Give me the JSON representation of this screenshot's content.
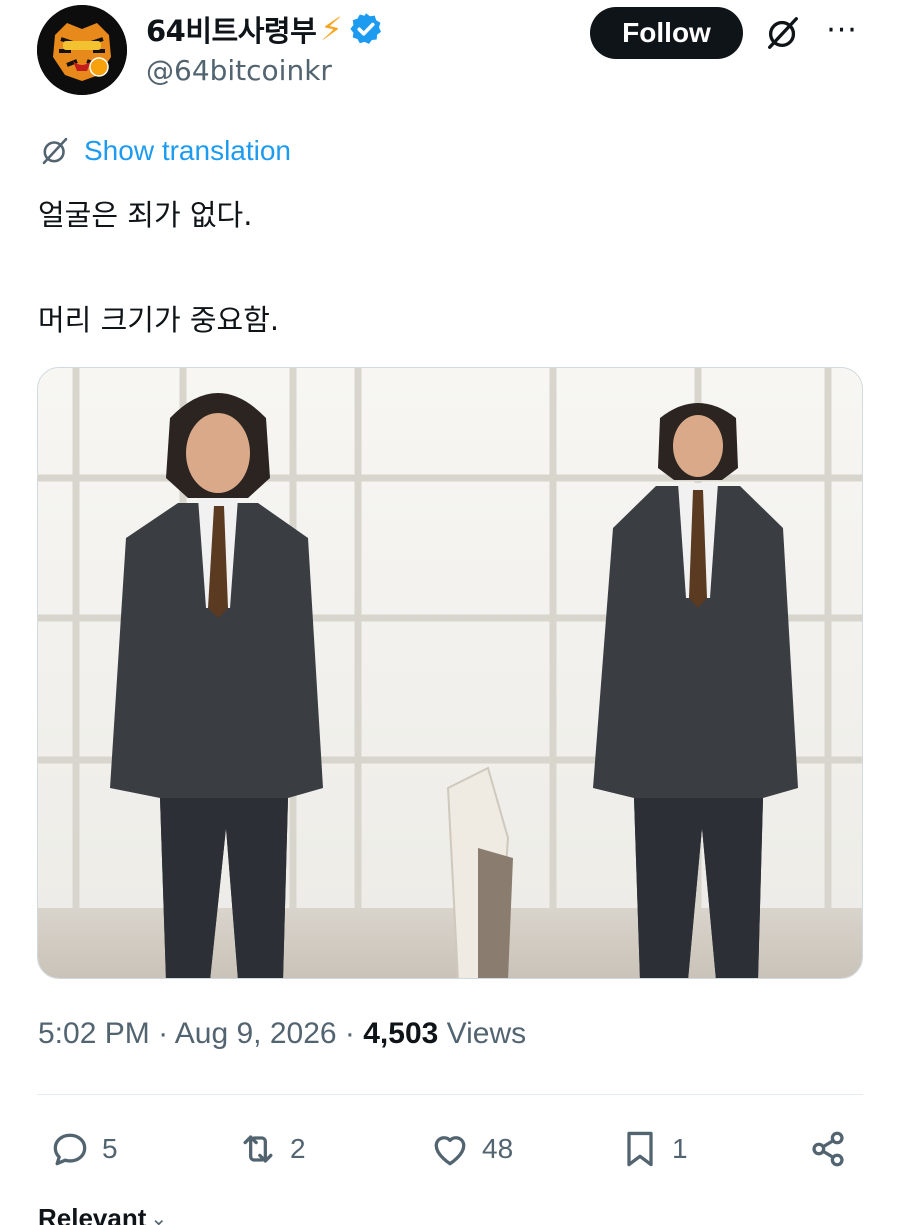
{
  "author": {
    "display_name": "64비트사령부",
    "emoji": "⚡",
    "handle": "@64bitcoinkr"
  },
  "header": {
    "follow_label": "Follow",
    "more_glyph": "···"
  },
  "translation": {
    "label": "Show translation"
  },
  "tweet": {
    "line1": "얼굴은 죄가 없다.",
    "line2": "머리 크기가 중요함."
  },
  "meta": {
    "time": "5:02 PM",
    "date": "Aug 9, 2026",
    "views_count": "4,503",
    "views_label": "Views"
  },
  "actions": {
    "replies": "5",
    "reposts": "2",
    "likes": "48",
    "bookmarks": "1"
  },
  "sort": {
    "label": "Relevant"
  },
  "colors": {
    "accent": "#1d9bf0",
    "text": "#0f1419",
    "secondary": "#536471"
  }
}
